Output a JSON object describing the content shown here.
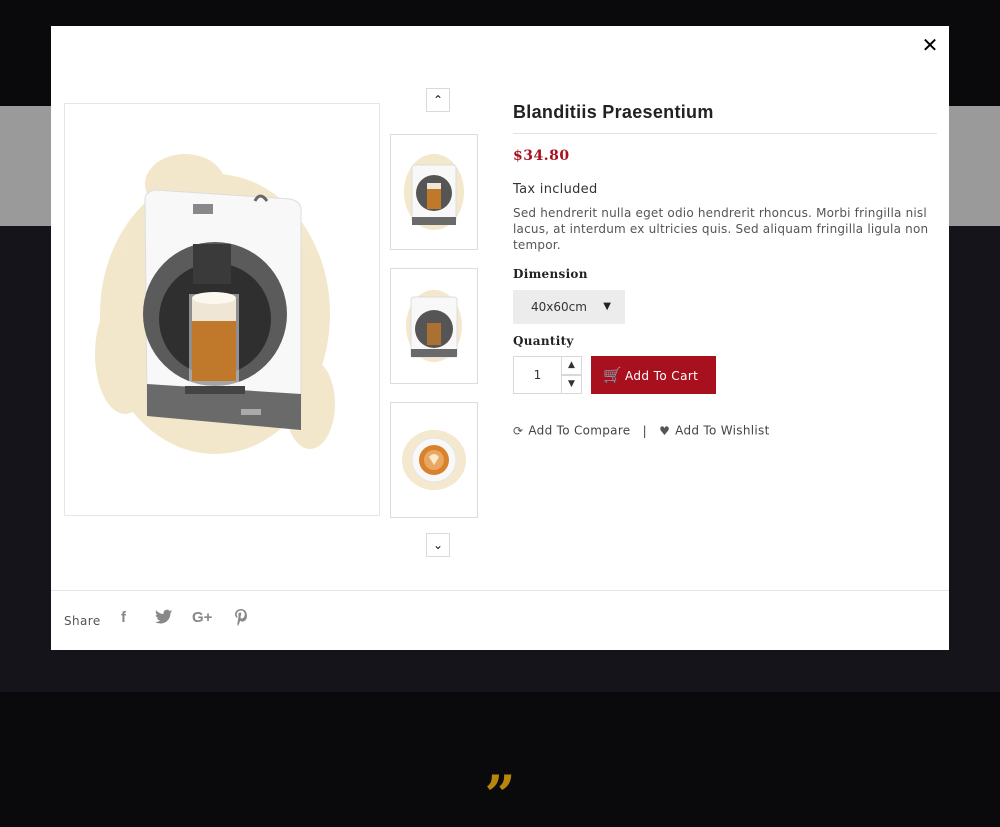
{
  "modal": {
    "close_label": "✕"
  },
  "product": {
    "title": "Blanditiis Praesentium",
    "price": "$34.80",
    "tax_note": "Tax included",
    "description": "Sed hendrerit nulla eget odio hendrerit rhoncus. Morbi fringilla nisl lacus, at interdum ex ultricies quis. Sed aliquam fringilla ligula non tempor.",
    "dimension_label": "Dimension",
    "dimension_value": "40x60cm",
    "quantity_label": "Quantity",
    "quantity_value": "1",
    "add_to_cart_label": "Add To Cart",
    "add_to_compare_label": "Add To Compare",
    "separator": "|",
    "add_to_wishlist_label": "Add To Wishlist"
  },
  "gallery": {
    "up_arrow": "⌃",
    "down_arrow": "⌄"
  },
  "share": {
    "label": "Share",
    "icons": [
      "facebook-icon",
      "twitter-icon",
      "google-plus-icon",
      "pinterest-icon"
    ]
  },
  "colors": {
    "accent": "#a8101e",
    "quote": "#b8860b"
  }
}
